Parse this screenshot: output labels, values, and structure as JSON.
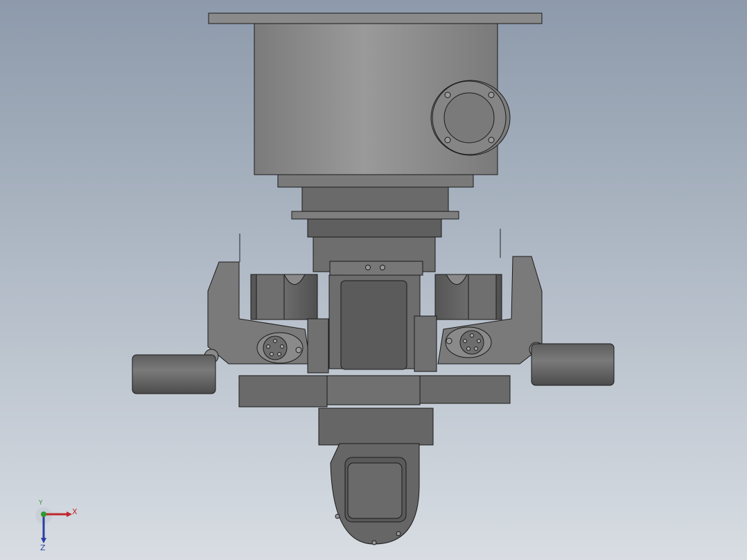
{
  "viewport": {
    "background_top": "#8d9aab",
    "background_bottom": "#d8dde3"
  },
  "model": {
    "description_icon": "robot-joint-assembly-icon",
    "colors": {
      "body": "#878787",
      "body_dark": "#5e5e5e",
      "edge": "#1a1a1a",
      "highlight": "#a3a3a3"
    }
  },
  "triad": {
    "x_label": "X",
    "y_label": "Y",
    "z_label": "Z",
    "x_color": "#c0272d",
    "y_color": "#2e9a2e",
    "z_color": "#2a3fa0"
  }
}
